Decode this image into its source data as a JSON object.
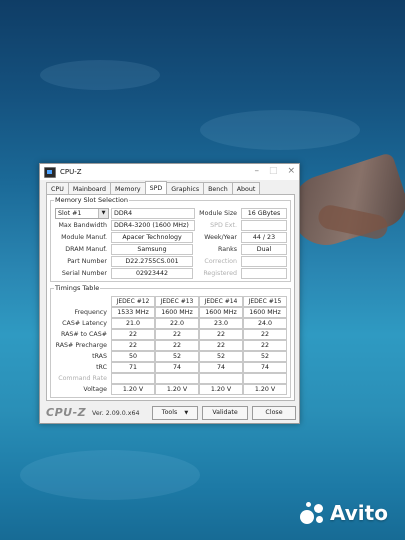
{
  "window": {
    "title": "CPU-Z"
  },
  "tabs": [
    {
      "label": "CPU",
      "active": false
    },
    {
      "label": "Mainboard",
      "active": false
    },
    {
      "label": "Memory",
      "active": false
    },
    {
      "label": "SPD",
      "active": true
    },
    {
      "label": "Graphics",
      "active": false
    },
    {
      "label": "Bench",
      "active": false
    },
    {
      "label": "About",
      "active": false
    }
  ],
  "slot": {
    "group_title": "Memory Slot Selection",
    "selected": "Slot #1",
    "type": "DDR4",
    "module_size_label": "Module Size",
    "module_size": "16 GBytes",
    "max_bandwidth_label": "Max Bandwidth",
    "max_bandwidth": "DDR4-3200 (1600 MHz)",
    "spd_ext_label": "SPD Ext.",
    "spd_ext": "",
    "module_manuf_label": "Module Manuf.",
    "module_manuf": "Apacer Technology",
    "week_year_label": "Week/Year",
    "week_year": "44 / 23",
    "dram_manuf_label": "DRAM Manuf.",
    "dram_manuf": "Samsung",
    "ranks_label": "Ranks",
    "ranks": "Dual",
    "part_number_label": "Part Number",
    "part_number": "D22.2755CS.001",
    "correction_label": "Correction",
    "correction": "",
    "serial_number_label": "Serial Number",
    "serial_number": "02923442",
    "registered_label": "Registered",
    "registered": ""
  },
  "timings": {
    "group_title": "Timings Table",
    "columns": [
      "JEDEC #12",
      "JEDEC #13",
      "JEDEC #14",
      "JEDEC #15"
    ],
    "rows": [
      {
        "label": "Frequency",
        "dim": false,
        "values": [
          "1533 MHz",
          "1600 MHz",
          "1600 MHz",
          "1600 MHz"
        ]
      },
      {
        "label": "CAS# Latency",
        "dim": false,
        "values": [
          "21.0",
          "22.0",
          "23.0",
          "24.0"
        ]
      },
      {
        "label": "RAS# to CAS#",
        "dim": false,
        "values": [
          "22",
          "22",
          "22",
          "22"
        ]
      },
      {
        "label": "RAS# Precharge",
        "dim": false,
        "values": [
          "22",
          "22",
          "22",
          "22"
        ]
      },
      {
        "label": "tRAS",
        "dim": false,
        "values": [
          "50",
          "52",
          "52",
          "52"
        ]
      },
      {
        "label": "tRC",
        "dim": false,
        "values": [
          "71",
          "74",
          "74",
          "74"
        ]
      },
      {
        "label": "Command Rate",
        "dim": true,
        "values": [
          "",
          "",
          "",
          ""
        ]
      },
      {
        "label": "Voltage",
        "dim": false,
        "values": [
          "1.20 V",
          "1.20 V",
          "1.20 V",
          "1.20 V"
        ]
      }
    ]
  },
  "footer": {
    "brand": "CPU-Z",
    "version": "Ver. 2.09.0.x64",
    "tools_label": "Tools",
    "validate_label": "Validate",
    "close_label": "Close"
  },
  "watermark": {
    "text": "Avito"
  }
}
